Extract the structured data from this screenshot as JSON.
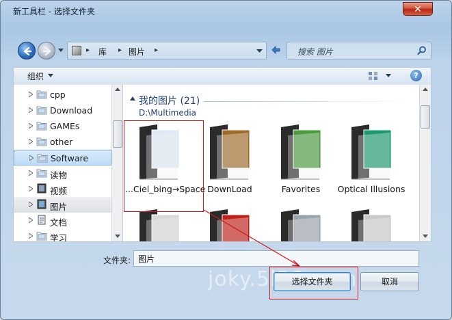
{
  "window": {
    "title": "新工具栏 - 选择文件夹",
    "close_glyph": "✕"
  },
  "address": {
    "crumbs": [
      "库",
      "图片"
    ],
    "search_placeholder": "搜索 图片"
  },
  "commandbar": {
    "organize_label": "组织",
    "help_glyph": "?"
  },
  "nav": {
    "items": [
      {
        "label": "cpp",
        "icon": "folder-icon"
      },
      {
        "label": "Download",
        "icon": "folder-icon"
      },
      {
        "label": "GAMEs",
        "icon": "folder-icon"
      },
      {
        "label": "other",
        "icon": "folder-icon"
      },
      {
        "label": "Software",
        "icon": "folder-icon",
        "selected": true
      },
      {
        "label": "读物",
        "icon": "folder-icon"
      },
      {
        "label": "视频",
        "icon": "library-video-icon"
      },
      {
        "label": "图片",
        "icon": "library-pictures-icon",
        "hot": true
      },
      {
        "label": "文档",
        "icon": "library-documents-icon"
      },
      {
        "label": "学习",
        "icon": "folder-icon"
      }
    ]
  },
  "content": {
    "group_title": "我的图片 (21)",
    "group_path": "D:\\Multimedia",
    "files": [
      {
        "name": "...Ciel_bing→Space"
      },
      {
        "name": "DownLoad"
      },
      {
        "name": "Favorites"
      },
      {
        "name": "Optical Illusions"
      },
      {
        "name": ""
      },
      {
        "name": ""
      },
      {
        "name": ""
      },
      {
        "name": ""
      }
    ]
  },
  "footer": {
    "folder_label": "文件夹:",
    "folder_value": "图片",
    "select_button": "选择文件夹",
    "cancel_button": "取消"
  },
  "watermark": "joky.5l56.com",
  "colors": {
    "annotation_red": "#d01818",
    "accent_blue": "#1e3f7a",
    "selection_blue": "#bedcf7"
  }
}
